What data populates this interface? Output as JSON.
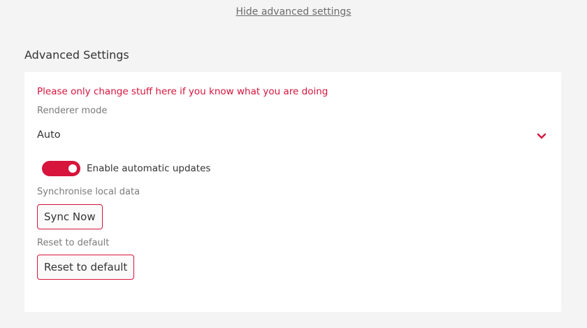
{
  "header": {
    "hide_link": "Hide advanced settings"
  },
  "section": {
    "title": "Advanced Settings"
  },
  "panel": {
    "warning": "Please only change stuff here if you know what you are doing",
    "renderer": {
      "label": "Renderer mode",
      "value": "Auto",
      "icon": "chevron-down-icon"
    },
    "auto_updates": {
      "label": "Enable automatic updates",
      "enabled": true
    },
    "sync": {
      "label": "Synchronise local data",
      "button": "Sync Now"
    },
    "reset": {
      "label": "Reset to default",
      "button": "Reset to default"
    }
  },
  "colors": {
    "accent": "#d6143c",
    "background": "#f4f4f4",
    "panel": "#ffffff",
    "muted_text": "#7a7a7a",
    "link": "#6b6b6b"
  }
}
